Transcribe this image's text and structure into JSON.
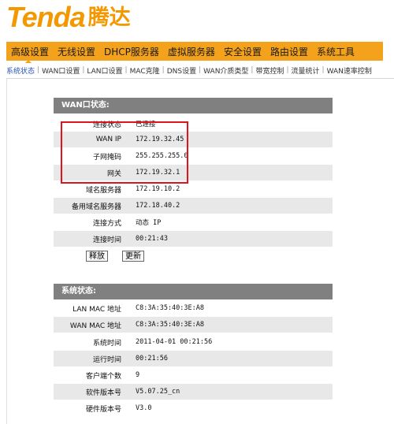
{
  "logo": {
    "latin": "Tenda",
    "cjk": "腾达"
  },
  "main_nav": [
    "高级设置",
    "无线设置",
    "DHCP服务器",
    "虚拟服务器",
    "安全设置",
    "路由设置",
    "系统工具"
  ],
  "sub_nav": [
    "系统状态",
    "WAN口设置",
    "LAN口设置",
    "MAC克隆",
    "DNS设置",
    "WAN介质类型",
    "带宽控制",
    "流量统计",
    "WAN速率控制"
  ],
  "wan_status": {
    "title": "WAN口状态:",
    "rows": [
      {
        "label": "连接状态",
        "value": "已连接"
      },
      {
        "label": "WAN IP",
        "value": "172.19.32.45"
      },
      {
        "label": "子网掩码",
        "value": "255.255.255.0"
      },
      {
        "label": "网关",
        "value": "172.19.32.1"
      },
      {
        "label": "域名服务器",
        "value": "172.19.10.2"
      },
      {
        "label": "备用域名服务器",
        "value": "172.18.40.2"
      },
      {
        "label": "连接方式",
        "value": "动态 IP"
      },
      {
        "label": "连接时间",
        "value": "00:21:43"
      }
    ],
    "release_label": "释放",
    "renew_label": "更新"
  },
  "system_status": {
    "title": "系统状态:",
    "rows": [
      {
        "label": "LAN MAC 地址",
        "value": "C8:3A:35:40:3E:A8"
      },
      {
        "label": "WAN MAC 地址",
        "value": "C8:3A:35:40:3E:A8"
      },
      {
        "label": "系统时间",
        "value": "2011-04-01 00:21:56"
      },
      {
        "label": "运行时间",
        "value": "00:21:56"
      },
      {
        "label": "客户端个数",
        "value": "9"
      },
      {
        "label": "软件版本号",
        "value": "V5.07.25_cn"
      },
      {
        "label": "硬件版本号",
        "value": "V3.0"
      }
    ]
  },
  "colors": {
    "brand": "#f39800",
    "nav_bg": "#f4a21c",
    "section_head": "#808080",
    "highlight": "#e0141c",
    "active_link": "#2a54b8"
  }
}
